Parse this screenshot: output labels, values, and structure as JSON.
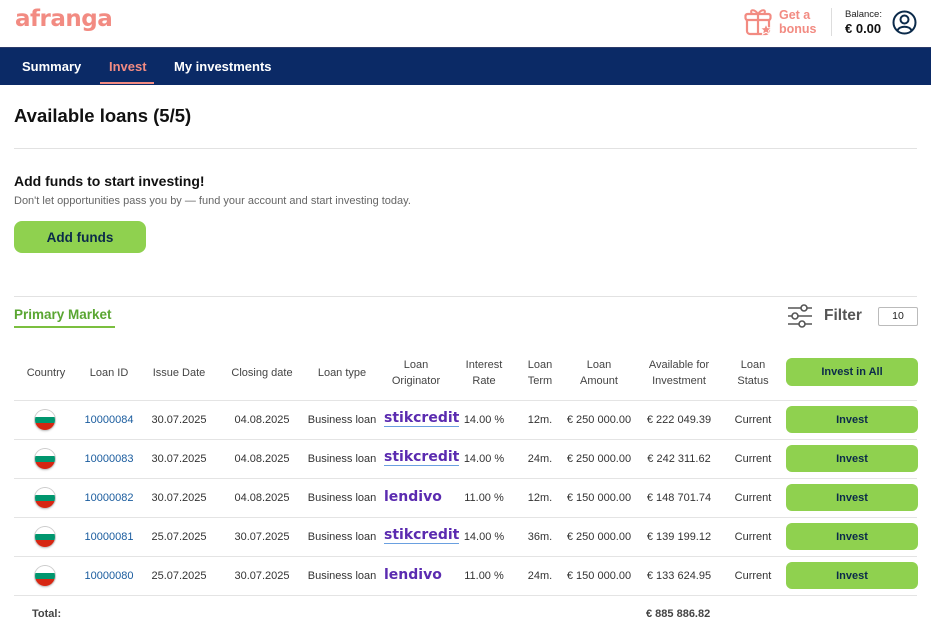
{
  "header": {
    "logo": "afranga",
    "bonus_line1": "Get a",
    "bonus_line2": "bonus",
    "balance_label": "Balance:",
    "balance_value": "€ 0.00"
  },
  "nav": {
    "items": [
      {
        "label": "Summary"
      },
      {
        "label": "Invest",
        "active": true
      },
      {
        "label": "My investments"
      }
    ]
  },
  "page": {
    "title": "Available loans  (5/5)"
  },
  "funds": {
    "title": "Add funds to start investing!",
    "subtitle": "Don't let opportunities pass you by — fund your account and start investing today.",
    "button": "Add funds"
  },
  "market": {
    "title": "Primary Market",
    "filter_label": "Filter",
    "page_size": "10"
  },
  "table": {
    "headers": {
      "country": "Country",
      "loan_id": "Loan ID",
      "issue_date": "Issue Date",
      "closing_date": "Closing date",
      "loan_type": "Loan type",
      "originator_1": "Loan",
      "originator_2": "Originator",
      "rate_1": "Interest",
      "rate_2": "Rate",
      "term_1": "Loan",
      "term_2": "Term",
      "amount_1": "Loan",
      "amount_2": "Amount",
      "available_1": "Available for",
      "available_2": "Investment",
      "status_1": "Loan",
      "status_2": "Status",
      "invest_all": "Invest in All"
    },
    "rows": [
      {
        "loan_id": "10000084",
        "issue_date": "30.07.2025",
        "closing_date": "04.08.2025",
        "loan_type": "Business loan",
        "originator": "stikcredit",
        "rate": "14.00 %",
        "term": "12m.",
        "amount": "€ 250 000.00",
        "available": "€ 222 049.39",
        "status": "Current",
        "action": "Invest"
      },
      {
        "loan_id": "10000083",
        "issue_date": "30.07.2025",
        "closing_date": "04.08.2025",
        "loan_type": "Business loan",
        "originator": "stikcredit",
        "rate": "14.00 %",
        "term": "24m.",
        "amount": "€ 250 000.00",
        "available": "€ 242 311.62",
        "status": "Current",
        "action": "Invest"
      },
      {
        "loan_id": "10000082",
        "issue_date": "30.07.2025",
        "closing_date": "04.08.2025",
        "loan_type": "Business loan",
        "originator": "lendivo",
        "rate": "11.00 %",
        "term": "12m.",
        "amount": "€ 150 000.00",
        "available": "€ 148 701.74",
        "status": "Current",
        "action": "Invest"
      },
      {
        "loan_id": "10000081",
        "issue_date": "25.07.2025",
        "closing_date": "30.07.2025",
        "loan_type": "Business loan",
        "originator": "stikcredit",
        "rate": "14.00 %",
        "term": "36m.",
        "amount": "€ 250 000.00",
        "available": "€ 139 199.12",
        "status": "Current",
        "action": "Invest"
      },
      {
        "loan_id": "10000080",
        "issue_date": "25.07.2025",
        "closing_date": "30.07.2025",
        "loan_type": "Business loan",
        "originator": "lendivo",
        "rate": "11.00 %",
        "term": "24m.",
        "amount": "€ 150 000.00",
        "available": "€ 133 624.95",
        "status": "Current",
        "action": "Invest"
      }
    ],
    "total_label": "Total:",
    "total_value": "€ 885 886.82"
  },
  "colors": {
    "brand_pink": "#f28b82",
    "nav_bg": "#0b2a66",
    "button_green": "#8fd14f",
    "market_green": "#5aa632",
    "link_blue": "#1a5c9e",
    "originator_purple": "#5b2bb0"
  },
  "icons": {
    "bonus": "gift-icon",
    "user": "user-circle-icon",
    "filter": "sliders-icon",
    "flag": "bulgaria-flag-icon"
  }
}
